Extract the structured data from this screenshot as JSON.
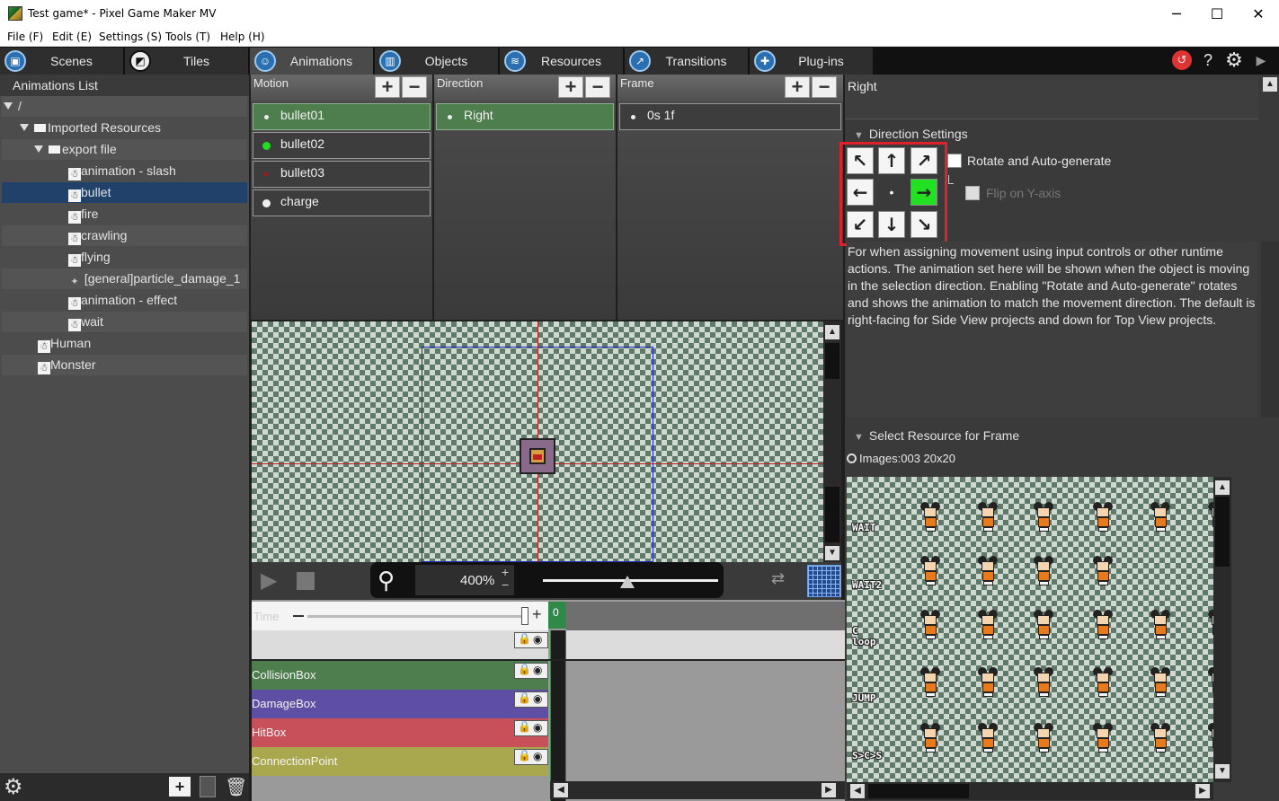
{
  "window": {
    "title": "Test game* - Pixel Game Maker MV",
    "minimize": "─",
    "maximize": "☐",
    "close": "✕"
  },
  "menu": [
    "File (F)",
    "Edit (E)",
    "Settings (S)",
    "Tools (T)",
    "Help (H)"
  ],
  "tabs": [
    {
      "label": "Scenes",
      "icon": "scenes-icon"
    },
    {
      "label": "Tiles",
      "icon": "tiles-icon"
    },
    {
      "label": "Animations",
      "icon": "animations-icon",
      "active": true
    },
    {
      "label": "Objects",
      "icon": "objects-icon"
    },
    {
      "label": "Resources",
      "icon": "resources-icon"
    },
    {
      "label": "Transitions",
      "icon": "transitions-icon"
    },
    {
      "label": "Plug-ins",
      "icon": "plugins-icon"
    }
  ],
  "toolbar_right": {
    "help": "?",
    "settings": "⚙",
    "play": "▶",
    "undo": "↺"
  },
  "animations_list": {
    "header": "Animations List",
    "root": "/",
    "imported": "Imported Resources",
    "export_folder": "export file",
    "items": [
      "animation - slash",
      "bullet",
      "fire",
      "crawling",
      "flying",
      "[general]particle_damage_1",
      "animation - effect",
      "wait"
    ],
    "selected": "bullet",
    "top_level": [
      "Human",
      "Monster"
    ]
  },
  "motion": {
    "header": "Motion",
    "items": [
      {
        "label": "bullet01",
        "dot": "#ffffff"
      },
      {
        "label": "bullet02",
        "dot": "#22dd22"
      },
      {
        "label": "bullet03",
        "dot": "#bb1111"
      },
      {
        "label": "charge",
        "dot": "#ffffff"
      }
    ]
  },
  "direction": {
    "header": "Direction",
    "items": [
      "Right"
    ]
  },
  "frame": {
    "header": "Frame",
    "items": [
      "0s 1f"
    ]
  },
  "plus": "+",
  "minus": "−",
  "zoom": {
    "value": "400%",
    "plus": "+",
    "minus": "−",
    "slider_level": 0.48
  },
  "timeline": {
    "time_label": "Time",
    "frame_index": "0",
    "tracks": [
      {
        "label": "CollisionBox",
        "color": "#4e7d4e"
      },
      {
        "label": "DamageBox",
        "color": "#5e4ea4"
      },
      {
        "label": "HitBox",
        "color": "#c8505a"
      },
      {
        "label": "ConnectionPoint",
        "color": "#a9a84e"
      }
    ]
  },
  "right": {
    "direction_name": "Right",
    "direction_settings_title": "Direction Settings",
    "rotate_label": "Rotate and Auto-generate",
    "flip_label": "Flip on Y-axis",
    "description": "For when assigning movement using input controls or other runtime actions. The animation set here will be shown when the object is moving in the selection direction. Enabling \"Rotate and Auto-generate\" rotates and shows the animation to match the movement direction. The default is right-facing for Side View projects and down for Top View projects.",
    "select_resource_title": "Select Resource for Frame",
    "resource_info": "Images:003 20x20",
    "arrows": [
      "↖",
      "↑",
      "↗",
      "←",
      "•",
      "→",
      "↙",
      "↓",
      "↘"
    ],
    "active_arrow": "→",
    "sprite_rows": [
      "WAIT",
      "WAIT2",
      "C\nloop",
      "JUMP",
      "S>C>S"
    ]
  }
}
